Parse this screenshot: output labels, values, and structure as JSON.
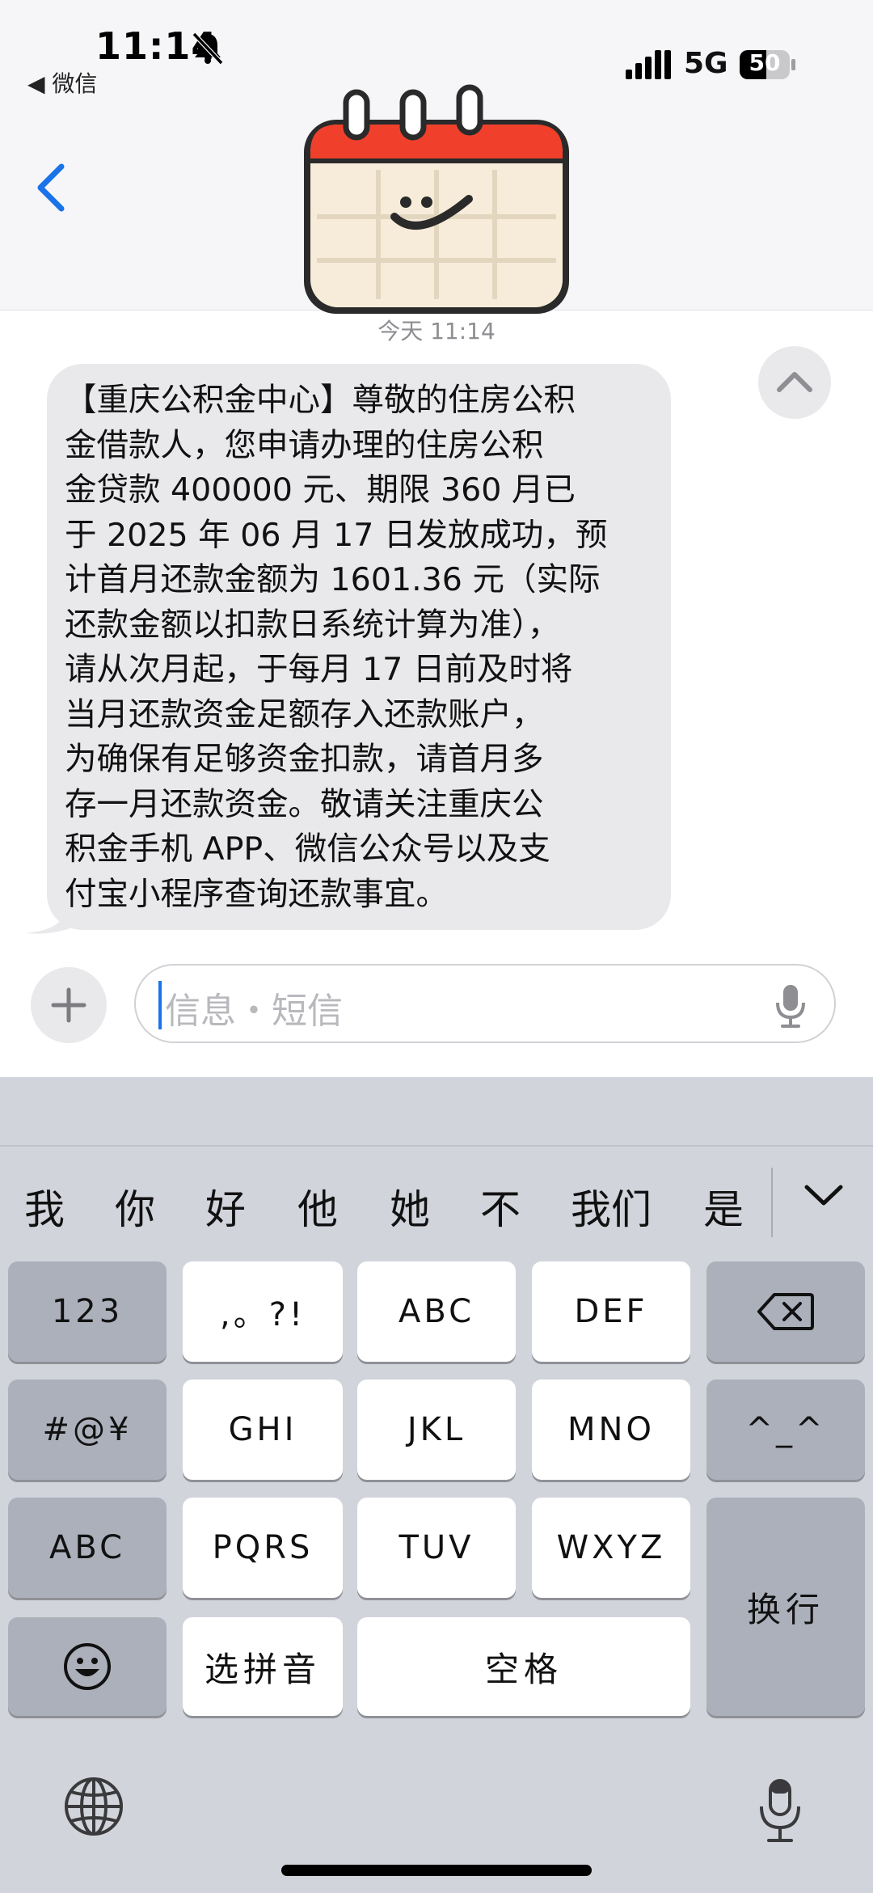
{
  "status_bar": {
    "time": "11:14",
    "back_app": "◀ 微信",
    "network": "5G",
    "battery": "50"
  },
  "thread": {
    "timestamp": "今天 11:14",
    "message": "【重庆公积金中心】尊敬的住房公积\n金借款人，您申请办理的住房公积\n金贷款 400000 元、期限 360 月已\n于 2025 年 06 月 17 日发放成功，预\n计首月还款金额为 1601.36 元（实际\n还款金额以扣款日系统计算为准），\n请从次月起，于每月 17 日前及时将\n当月还款资金足额存入还款账户，\n为确保有足够资金扣款，请首月多\n存一月还款资金。敬请关注重庆公\n积金手机 APP、微信公众号以及支\n付宝小程序查询还款事宜。"
  },
  "compose": {
    "placeholder": "信息・短信"
  },
  "keyboard": {
    "candidates": [
      "我",
      "你",
      "好",
      "他",
      "她",
      "不",
      "我们",
      "是"
    ],
    "keys": {
      "num": "123",
      "punct": ",。?!",
      "abc_top": "ABC",
      "def": "DEF",
      "symbols": "#@¥",
      "ghi": "GHI",
      "jkl": "JKL",
      "mno": "MNO",
      "emoticon": "^_^",
      "abc_mode": "ABC",
      "pqrs": "PQRS",
      "tuv": "TUV",
      "wxyz": "WXYZ",
      "return": "换行",
      "pinyin": "选拼音",
      "space": "空格"
    }
  },
  "colors": {
    "accent": "#1a73e8",
    "bubble": "#e9e9eb",
    "keyboard_bg": "#d2d4db",
    "calendar_red": "#f0402c"
  }
}
